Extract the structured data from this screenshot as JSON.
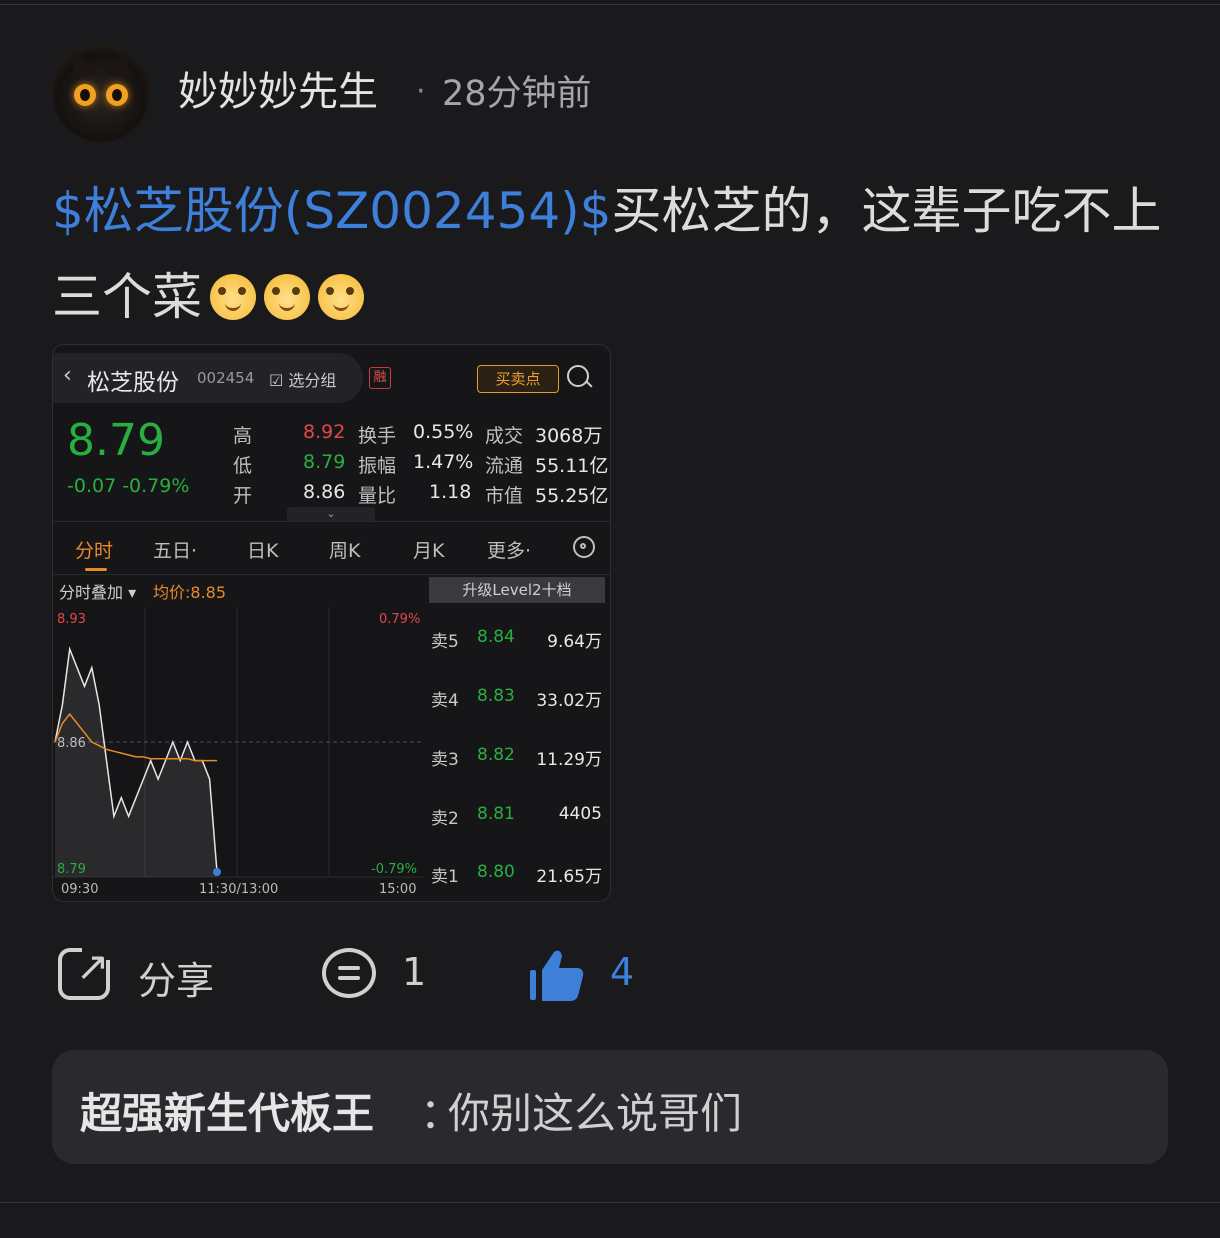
{
  "post": {
    "author": "妙妙妙先生",
    "time_ago": "28分钟前",
    "tag": "$松芝股份(SZ002454)$",
    "text": "买松芝的，这辈子吃不上三个菜",
    "emoji_count": 3
  },
  "screenshot": {
    "back": "‹",
    "name": "松芝股份",
    "code": "002454",
    "group_btn": "☑ 选分组",
    "rong": "融",
    "trade_btn": "买卖点",
    "price": "8.79",
    "change": "-0.07 -0.79%",
    "stats": [
      {
        "l1": "高",
        "v1": "8.92",
        "l2": "换手",
        "v2": "0.55%",
        "l3": "成交",
        "v3": "3068万"
      },
      {
        "l1": "低",
        "v1": "8.79",
        "l2": "振幅",
        "v2": "1.47%",
        "l3": "流通",
        "v3": "55.11亿"
      },
      {
        "l1": "开",
        "v1": "8.86",
        "l2": "量比",
        "v2": "1.18",
        "l3": "市值",
        "v3": "55.25亿"
      }
    ],
    "collapse": "⌄",
    "tabs": [
      "分时",
      "五日·",
      "日K",
      "周K",
      "月K",
      "更多·"
    ],
    "overlay": "分时叠加 ▾",
    "avg": "均价:8.85",
    "level2": "升级Level2十档",
    "chart_labels": {
      "high": "8.93",
      "mid": "8.86",
      "low": "8.79",
      "pct_high": "0.79%",
      "pct_low": "-0.79%",
      "t_start": "09:30",
      "t_mid": "11:30/13:00",
      "t_end": "15:00"
    },
    "orders": [
      {
        "label": "卖5",
        "price": "8.84",
        "vol": "9.64万"
      },
      {
        "label": "卖4",
        "price": "8.83",
        "vol": "33.02万"
      },
      {
        "label": "卖3",
        "price": "8.82",
        "vol": "11.29万"
      },
      {
        "label": "卖2",
        "price": "8.81",
        "vol": "4405"
      },
      {
        "label": "卖1",
        "price": "8.80",
        "vol": "21.65万"
      }
    ],
    "price_series": [
      8.86,
      8.88,
      8.91,
      8.9,
      8.89,
      8.9,
      8.88,
      8.85,
      8.82,
      8.83,
      8.82,
      8.83,
      8.84,
      8.85,
      8.84,
      8.85,
      8.86,
      8.85,
      8.86,
      8.85,
      8.85,
      8.84,
      8.79
    ],
    "avg_series": [
      8.86,
      8.87,
      8.875,
      8.87,
      8.865,
      8.86,
      8.858,
      8.856,
      8.855,
      8.854,
      8.853,
      8.852,
      8.852,
      8.851,
      8.851,
      8.851,
      8.851,
      8.851,
      8.851,
      8.85,
      8.85,
      8.85,
      8.85
    ]
  },
  "actions": {
    "share": "分享",
    "comments": "1",
    "likes": "4"
  },
  "reply": {
    "name": "超强新生代板王",
    "colon": "：",
    "text": "你别这么说哥们"
  },
  "colors": {
    "accent": "#3d7fd9",
    "up": "#e24848",
    "down": "#27b040",
    "avg_line": "#e88a2a"
  }
}
